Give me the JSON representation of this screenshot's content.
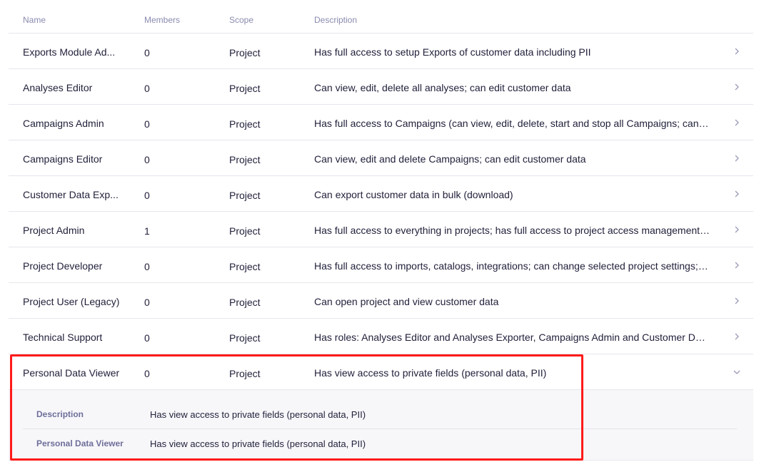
{
  "table": {
    "columns": {
      "name": "Name",
      "members": "Members",
      "scope": "Scope",
      "description": "Description"
    },
    "rows": [
      {
        "name": "Exports Module Ad...",
        "members": "0",
        "scope": "Project",
        "description": "Has full access to setup Exports of customer data including PII"
      },
      {
        "name": "Analyses Editor",
        "members": "0",
        "scope": "Project",
        "description": "Can view, edit, delete all analyses; can edit customer data"
      },
      {
        "name": "Campaigns Admin",
        "members": "0",
        "scope": "Project",
        "description": "Has full access to Campaigns (can view, edit, delete, start and stop all Campaigns; can edi..."
      },
      {
        "name": "Campaigns Editor",
        "members": "0",
        "scope": "Project",
        "description": "Can view, edit and delete Campaigns; can edit customer data"
      },
      {
        "name": "Customer Data Exp...",
        "members": "0",
        "scope": "Project",
        "description": "Can export customer data in bulk (download)"
      },
      {
        "name": "Project Admin",
        "members": "1",
        "scope": "Project",
        "description": "Has full access to everything in projects; has full access to project access management; c..."
      },
      {
        "name": "Project Developer",
        "members": "0",
        "scope": "Project",
        "description": "Has full access to imports, catalogs, integrations; can change selected project settings; ca..."
      },
      {
        "name": "Project User (Legacy)",
        "members": "0",
        "scope": "Project",
        "description": "Can open project and view customer data"
      },
      {
        "name": "Technical Support",
        "members": "0",
        "scope": "Project",
        "description": "Has roles: Analyses Editor and Analyses Exporter, Campaigns Admin and Customer Data ..."
      },
      {
        "name": "Personal Data Viewer",
        "members": "0",
        "scope": "Project",
        "description": "Has view access to private fields (personal data, PII)"
      }
    ],
    "expanded": {
      "details": [
        {
          "label": "Description",
          "value": "Has view access to private fields (personal data, PII)"
        },
        {
          "label": "Personal Data Viewer",
          "value": "Has view access to private fields (personal data, PII)"
        }
      ]
    }
  },
  "icons": {
    "row_chevron": "chevron-right-icon",
    "expanded_chevron": "chevron-down-icon"
  },
  "colors": {
    "highlight_border": "#ff1a1a",
    "header_text": "#8a8ab0",
    "detail_label": "#6e6e9a",
    "expanded_bg": "#f7f7fa"
  }
}
